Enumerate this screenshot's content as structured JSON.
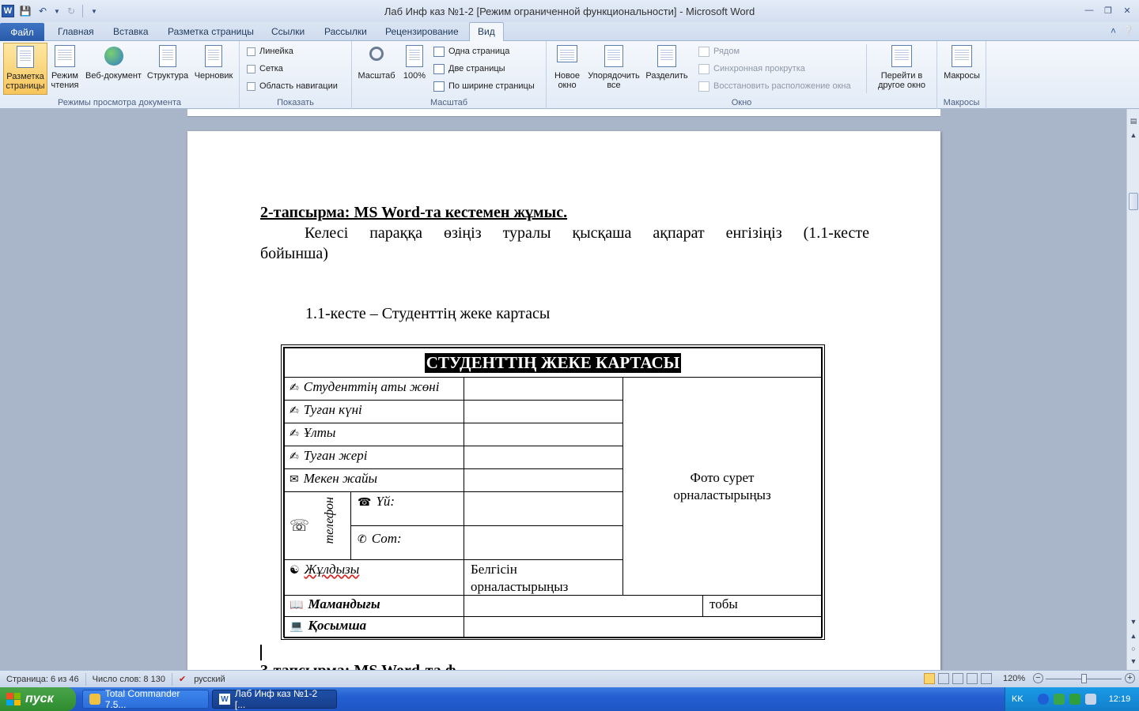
{
  "window": {
    "title": "Лаб Инф каз №1-2 [Режим ограниченной функциональности]  -  Microsoft Word",
    "app_icon": "W"
  },
  "ribbon_tabs": {
    "file": "Файл",
    "items": [
      "Главная",
      "Вставка",
      "Разметка страницы",
      "Ссылки",
      "Рассылки",
      "Рецензирование",
      "Вид"
    ],
    "active": "Вид"
  },
  "groups": {
    "views": {
      "label": "Режимы просмотра документа",
      "buttons": [
        "Разметка страницы",
        "Режим чтения",
        "Веб-документ",
        "Структура",
        "Черновик"
      ]
    },
    "show": {
      "label": "Показать",
      "checkboxes": [
        "Линейка",
        "Сетка",
        "Область навигации"
      ]
    },
    "zoom": {
      "label": "Масштаб",
      "zoom_button": "Масштаб",
      "percent_button": "100%",
      "small": [
        "Одна страница",
        "Две страницы",
        "По ширине страницы"
      ]
    },
    "window": {
      "label": "Окно",
      "new_window": "Новое окно",
      "arrange": "Упорядочить все",
      "split": "Разделить",
      "small": [
        "Рядом",
        "Синхронная прокрутка",
        "Восстановить расположение окна"
      ],
      "switch": "Перейти в другое окно"
    },
    "macros": {
      "label": "Макросы",
      "button": "Макросы"
    }
  },
  "document": {
    "heading": "2-тапсырма: MS Word-та кестемен жұмыс.",
    "para1": "Келесі параққа өзіңіз туралы қысқаша ақпарат енгізіңіз (1.1-кесте",
    "para1b": "бойынша)",
    "table_caption": "1.1-кесте – Студенттің жеке картасы",
    "card": {
      "title": "СТУДЕНТТІҢ ЖЕКЕ КАРТАСЫ",
      "rows": [
        "Студенттің аты жөні",
        "Туған күні",
        "Ұлты",
        "Туған жері",
        "Мекен жайы"
      ],
      "phone_label": "телефон",
      "home": "Үй:",
      "mobile": "Сот:",
      "zodiac": "Жұлдызы",
      "zodiac_hint": "Белгісін орналастырыңыз",
      "photo": "Фото сурет орналастырыңыз",
      "specialty": "Мамандығы",
      "group": "тобы",
      "extra": "Қосымша"
    },
    "next_heading_partial": "3-тапсырма: MS Word-та ф"
  },
  "statusbar": {
    "page": "Страница: 6 из 46",
    "words": "Число слов: 8 130",
    "language": "русский",
    "zoom": "120%"
  },
  "taskbar": {
    "start": "пуск",
    "tasks": [
      "Total Commander 7.5...",
      "Лаб Инф каз №1-2 [..."
    ],
    "lang": "KK",
    "clock": "12:19"
  }
}
